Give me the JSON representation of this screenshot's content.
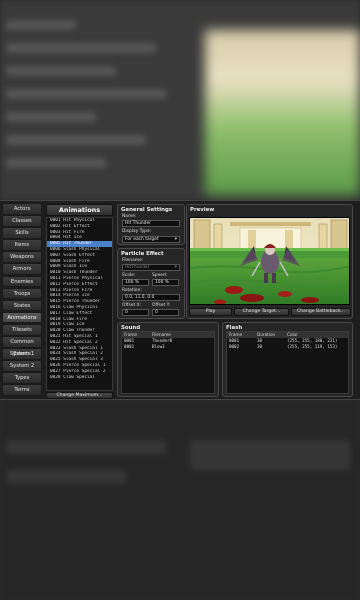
{
  "nav": {
    "items": [
      "Actors",
      "Classes",
      "Skills",
      "Items",
      "Weapons",
      "Armors",
      "Enemies",
      "Troops",
      "States",
      "Animations",
      "Tilesets",
      "Common Events",
      "System 1",
      "System 2",
      "Types",
      "Terms"
    ],
    "active_index": 9
  },
  "animations": {
    "title": "Animations",
    "items": [
      "0001 Hit Physical",
      "0002 Hit Effect",
      "0003 Hit Fire",
      "0004 Hit Ice",
      "0005 Hit Thunder",
      "0006 Slash Physical",
      "0007 Slash Effect",
      "0008 Slash Fire",
      "0009 Slash Ice",
      "0010 Slash Thunder",
      "0011 Pierce Physical",
      "0012 Pierce Effect",
      "0013 Pierce Fire",
      "0014 Pierce Ice",
      "0015 Pierce Thunder",
      "0016 Claw Physical",
      "0017 Claw Effect",
      "0018 Claw Fire",
      "0019 Claw Ice",
      "0020 Claw Thunder",
      "0021 Hit Special 1",
      "0022 Hit Special 2",
      "0023 Slash Special 1",
      "0024 Slash Special 2",
      "0025 Slash Special 3",
      "0026 Pierce Special 1",
      "0027 Pierce Special 2",
      "0028 Claw Special"
    ],
    "selected_index": 4,
    "change_max_label": "Change Maximum..."
  },
  "general": {
    "title": "General Settings",
    "name_label": "Name:",
    "name_value": "Hit Thunder",
    "display_type_label": "Display Type:",
    "display_type_value": "For each target"
  },
  "particle": {
    "title": "Particle Effect",
    "filename_label": "Filename:",
    "filename_value": "HitThunder",
    "scale_label": "Scale:",
    "scale_value": "100 %",
    "speed_label": "Speed:",
    "speed_value": "100 %",
    "rotation_label": "Rotation:",
    "rotation_value": "0.0,  11.0,  0.0",
    "offset_x_label": "Offset X:",
    "offset_x_value": "0",
    "offset_y_label": "Offset Y:",
    "offset_y_value": "0"
  },
  "preview": {
    "title": "Preview",
    "play_label": "Play",
    "change_target_label": "Change Target...",
    "change_battleback_label": "Change Battleback..."
  },
  "sound": {
    "title": "Sound",
    "columns": [
      "Frame",
      "Filename"
    ],
    "rows": [
      [
        "0001",
        "Thunder8"
      ],
      [
        "0001",
        "Blow3"
      ]
    ]
  },
  "flash": {
    "title": "Flash",
    "columns": [
      "Frame",
      "Duration",
      "Color"
    ],
    "rows": [
      [
        "0001",
        "30",
        "(255, 255, 180, 221)"
      ],
      [
        "0002",
        "30",
        "(255, 255, 119, 153)"
      ]
    ]
  },
  "colors": {
    "selection": "#4a7fc9",
    "window_bg": "#1e1e1e",
    "panel_border": "#4a4a4a"
  }
}
